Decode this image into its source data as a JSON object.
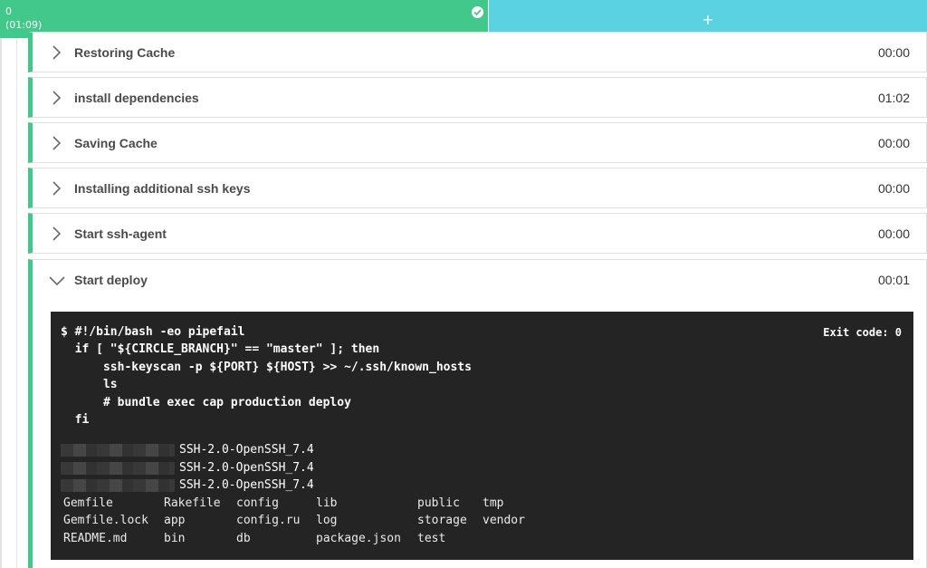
{
  "container": {
    "index": "0",
    "duration": "(01:09)",
    "add_label": "+"
  },
  "colors": {
    "success": "#42c88a",
    "add_tab": "#5ad2e1",
    "terminal_bg": "#242424"
  },
  "steps": [
    {
      "name": "Restoring Cache",
      "duration": "00:00",
      "icon": "chevron-right-icon"
    },
    {
      "name": "install dependencies",
      "duration": "01:02",
      "icon": "chevron-right-icon"
    },
    {
      "name": "Saving Cache",
      "duration": "00:00",
      "icon": "chevron-right-icon"
    },
    {
      "name": "Installing additional ssh keys",
      "duration": "00:00",
      "icon": "chevron-right-icon"
    },
    {
      "name": "Start ssh-agent",
      "duration": "00:00",
      "icon": "chevron-right-icon"
    }
  ],
  "open_step": {
    "name": "Start deploy",
    "duration": "00:01",
    "icon": "chevron-down-icon",
    "exit_code": "Exit code: 0",
    "command": [
      "$ #!/bin/bash -eo pipefail",
      "  if [ \"${CIRCLE_BRANCH}\" == \"master\" ]; then",
      "      ssh-keyscan -p ${PORT} ${HOST} >> ~/.ssh/known_hosts",
      "      ls",
      "      # bundle exec cap production deploy",
      "  fi"
    ],
    "keyscan_output": [
      "SSH-2.0-OpenSSH_7.4",
      "SSH-2.0-OpenSSH_7.4",
      "SSH-2.0-OpenSSH_7.4"
    ],
    "ls_output": [
      [
        "Gemfile",
        "Rakefile",
        "config",
        "lib",
        "public",
        "tmp"
      ],
      [
        "Gemfile.lock",
        "app",
        "config.ru",
        "log",
        "storage",
        "vendor"
      ],
      [
        "README.md",
        "bin",
        "db",
        "package.json",
        "test",
        ""
      ]
    ]
  }
}
